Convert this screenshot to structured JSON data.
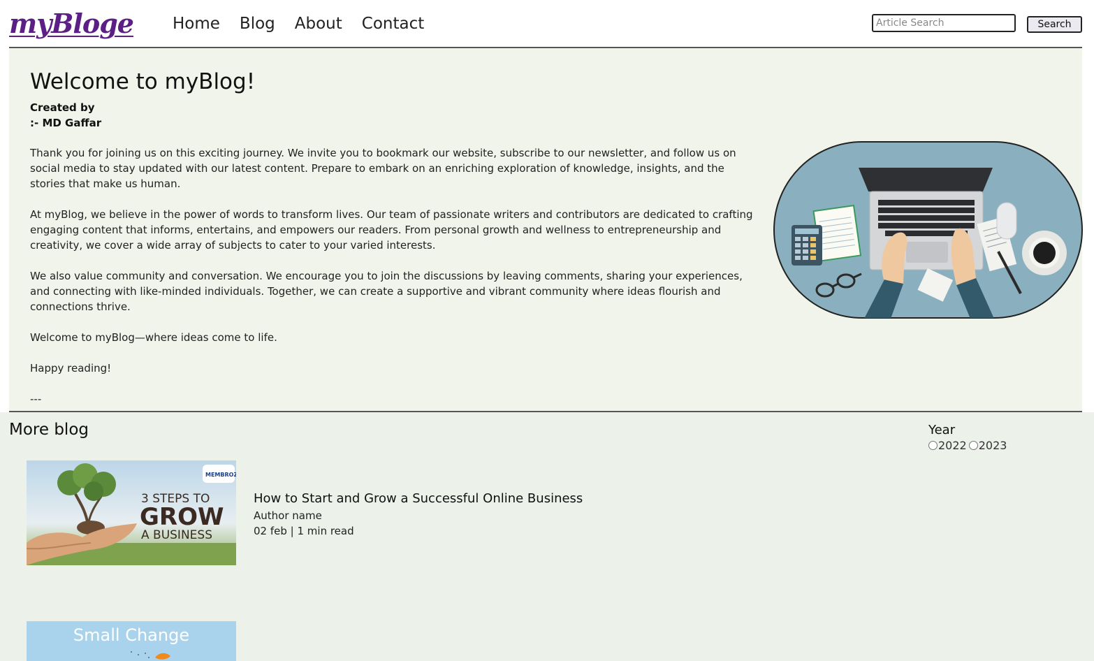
{
  "header": {
    "logo": "myBloge",
    "nav": [
      "Home",
      "Blog",
      "About",
      "Contact"
    ],
    "search_placeholder": "Article Search",
    "search_button": "Search"
  },
  "hero": {
    "title": "Welcome to myBlog!",
    "created_by": "Created by",
    "author": ":- MD Gaffar",
    "paragraphs": [
      "Thank you for joining us on this exciting journey. We invite you to bookmark our website, subscribe to our newsletter, and follow us on social media to stay updated with our latest content. Prepare to embark on an enriching exploration of knowledge, insights, and the stories that make us human.",
      "At myBlog, we believe in the power of words to transform lives. Our team of passionate writers and contributors are dedicated to crafting engaging content that informs, entertains, and empowers our readers. From personal growth and wellness to entrepreneurship and creativity, we cover a wide array of subjects to cater to your varied interests.",
      "We also value community and conversation. We encourage you to join the discussions by leaving comments, sharing your experiences, and connecting with like-minded individuals. Together, we can create a supportive and vibrant community where ideas flourish and connections thrive.",
      "Welcome to myBlog—where ideas come to life.",
      "Happy reading!",
      "---"
    ]
  },
  "more": {
    "heading": "More blog",
    "year_label": "Year",
    "years": [
      "2022",
      "2023"
    ],
    "posts": [
      {
        "title": "How to Start and Grow a Successful Online Business",
        "author": "Author name",
        "meta": "02 feb | 1 min read",
        "image_text": {
          "brand": "MEMBROZ",
          "line1": "3 STEPS TO",
          "line2": "GROW",
          "line3": "A BUSINESS"
        }
      },
      {
        "image_text": {
          "line1": "Small Change"
        }
      }
    ]
  },
  "colors": {
    "logo": "#5b1f86",
    "hero_bg": "#f1f4ea",
    "more_bg": "#ecf1ea",
    "illustration_bg": "#8aafbf"
  }
}
